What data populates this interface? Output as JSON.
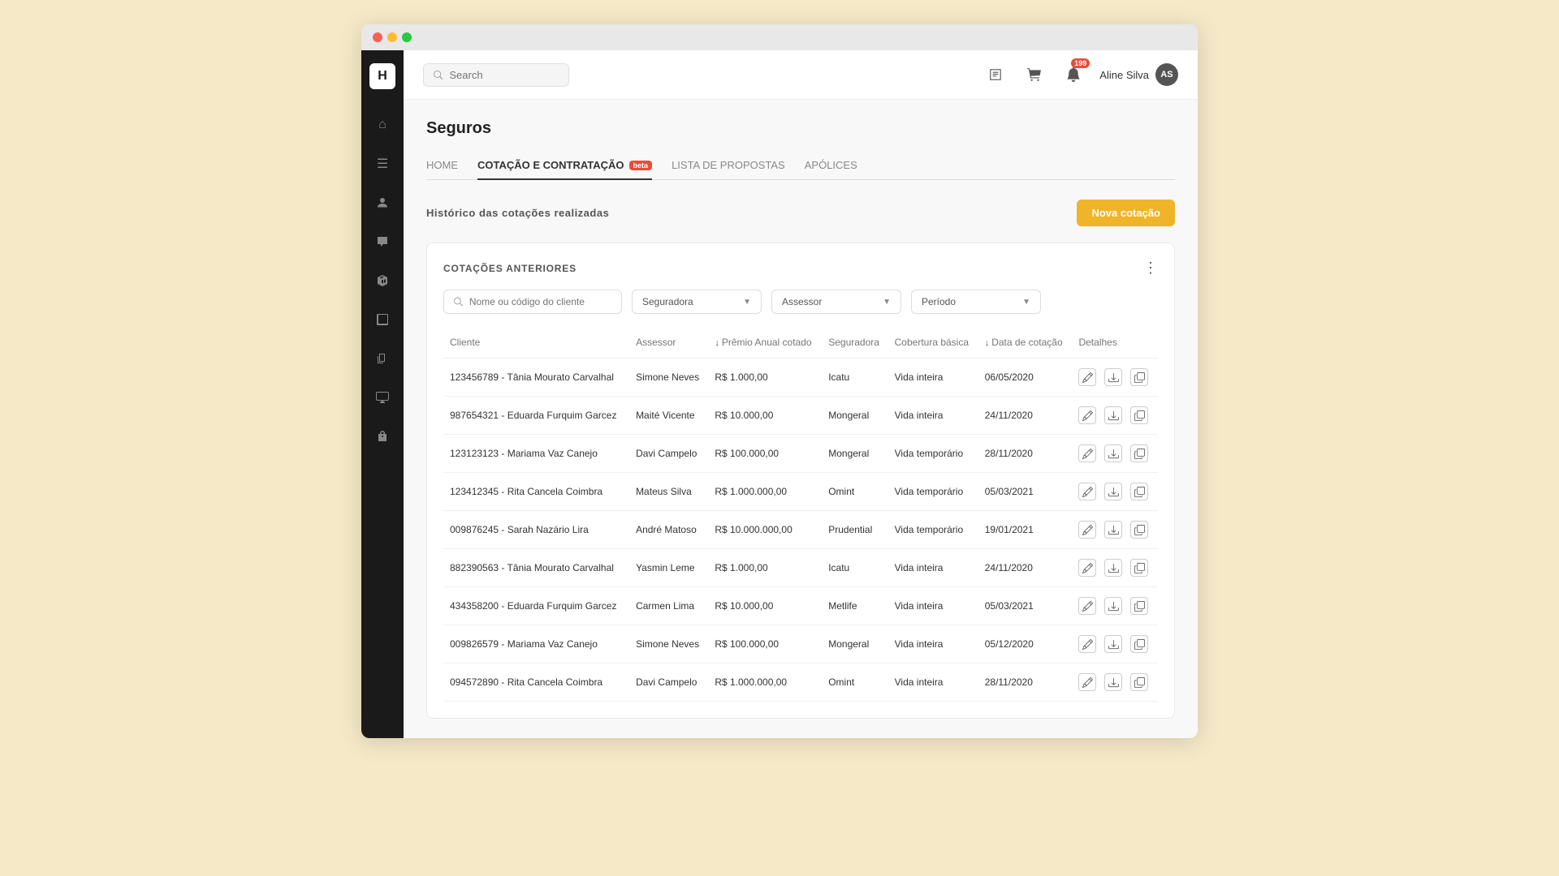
{
  "window": {
    "title": "Seguros"
  },
  "topbar": {
    "search_placeholder": "Search",
    "user_name": "Aline Silva",
    "user_initials": "AS",
    "notification_badge": "199"
  },
  "sidebar": {
    "logo": "H",
    "icons": [
      {
        "name": "home-icon",
        "symbol": "⌂"
      },
      {
        "name": "list-icon",
        "symbol": "≡"
      },
      {
        "name": "person-icon",
        "symbol": "👤"
      },
      {
        "name": "chat-icon",
        "symbol": "💬"
      },
      {
        "name": "box-icon",
        "symbol": "⬛"
      },
      {
        "name": "book-icon",
        "symbol": "📖"
      },
      {
        "name": "copy-icon",
        "symbol": "📋"
      },
      {
        "name": "monitor-icon",
        "symbol": "🖥"
      },
      {
        "name": "lock-icon",
        "symbol": "🔒"
      }
    ]
  },
  "page": {
    "title": "Seguros",
    "tabs": [
      {
        "label": "HOME",
        "active": false
      },
      {
        "label": "COTAÇÃO E CONTRATAÇÃO",
        "active": true,
        "badge": "beta"
      },
      {
        "label": "LISTA DE PROPOSTAS",
        "active": false
      },
      {
        "label": "APÓLICES",
        "active": false
      }
    ]
  },
  "section": {
    "title": "Histórico das cotações realizadas",
    "button_label": "Nova cotação",
    "card_title": "COTAÇÕES ANTERIORES"
  },
  "filters": {
    "search_placeholder": "Nome ou código do cliente",
    "seguradora_label": "Seguradora",
    "assessor_label": "Assessor",
    "periodo_label": "Período"
  },
  "table": {
    "columns": [
      {
        "key": "cliente",
        "label": "Cliente",
        "sortable": false
      },
      {
        "key": "assessor",
        "label": "Assessor",
        "sortable": false
      },
      {
        "key": "premio",
        "label": "Prêmio Anual cotado",
        "sortable": true
      },
      {
        "key": "seguradora",
        "label": "Seguradora",
        "sortable": false
      },
      {
        "key": "cobertura",
        "label": "Cobertura básica",
        "sortable": false
      },
      {
        "key": "data",
        "label": "Data de cotação",
        "sortable": true
      },
      {
        "key": "detalhes",
        "label": "Detalhes",
        "sortable": false
      }
    ],
    "rows": [
      {
        "cliente": "123456789 - Tânia Mourato Carvalhal",
        "assessor": "Simone Neves",
        "premio": "R$ 1.000,00",
        "seguradora": "Icatu",
        "cobertura": "Vida inteira",
        "data": "06/05/2020"
      },
      {
        "cliente": "987654321 - Eduarda Furquim Garcez",
        "assessor": "Maité Vicente",
        "premio": "R$ 10.000,00",
        "seguradora": "Mongeral",
        "cobertura": "Vida inteira",
        "data": "24/11/2020"
      },
      {
        "cliente": "123123123 - Mariama Vaz Canejo",
        "assessor": "Davi Campelo",
        "premio": "R$ 100.000,00",
        "seguradora": "Mongeral",
        "cobertura": "Vida temporário",
        "data": "28/11/2020"
      },
      {
        "cliente": "123412345 - Rita Cancela Coimbra",
        "assessor": "Mateus Silva",
        "premio": "R$ 1.000.000,00",
        "seguradora": "Omint",
        "cobertura": "Vida temporário",
        "data": "05/03/2021"
      },
      {
        "cliente": "009876245 - Sarah Nazário Lira",
        "assessor": "André Matoso",
        "premio": "R$ 10.000.000,00",
        "seguradora": "Prudential",
        "cobertura": "Vida temporário",
        "data": "19/01/2021"
      },
      {
        "cliente": "882390563 - Tânia Mourato Carvalhal",
        "assessor": "Yasmin Leme",
        "premio": "R$ 1.000,00",
        "seguradora": "Icatu",
        "cobertura": "Vida inteira",
        "data": "24/11/2020"
      },
      {
        "cliente": "434358200 - Eduarda Furquim Garcez",
        "assessor": "Carmen Lima",
        "premio": "R$ 10.000,00",
        "seguradora": "Metlife",
        "cobertura": "Vida inteira",
        "data": "05/03/2021"
      },
      {
        "cliente": "009826579 - Mariama Vaz Canejo",
        "assessor": "Simone Neves",
        "premio": "R$ 100.000,00",
        "seguradora": "Mongeral",
        "cobertura": "Vida inteira",
        "data": "05/12/2020"
      },
      {
        "cliente": "094572890 - Rita Cancela Coimbra",
        "assessor": "Davi Campelo",
        "premio": "R$ 1.000.000,00",
        "seguradora": "Omint",
        "cobertura": "Vida inteira",
        "data": "28/11/2020"
      }
    ]
  }
}
